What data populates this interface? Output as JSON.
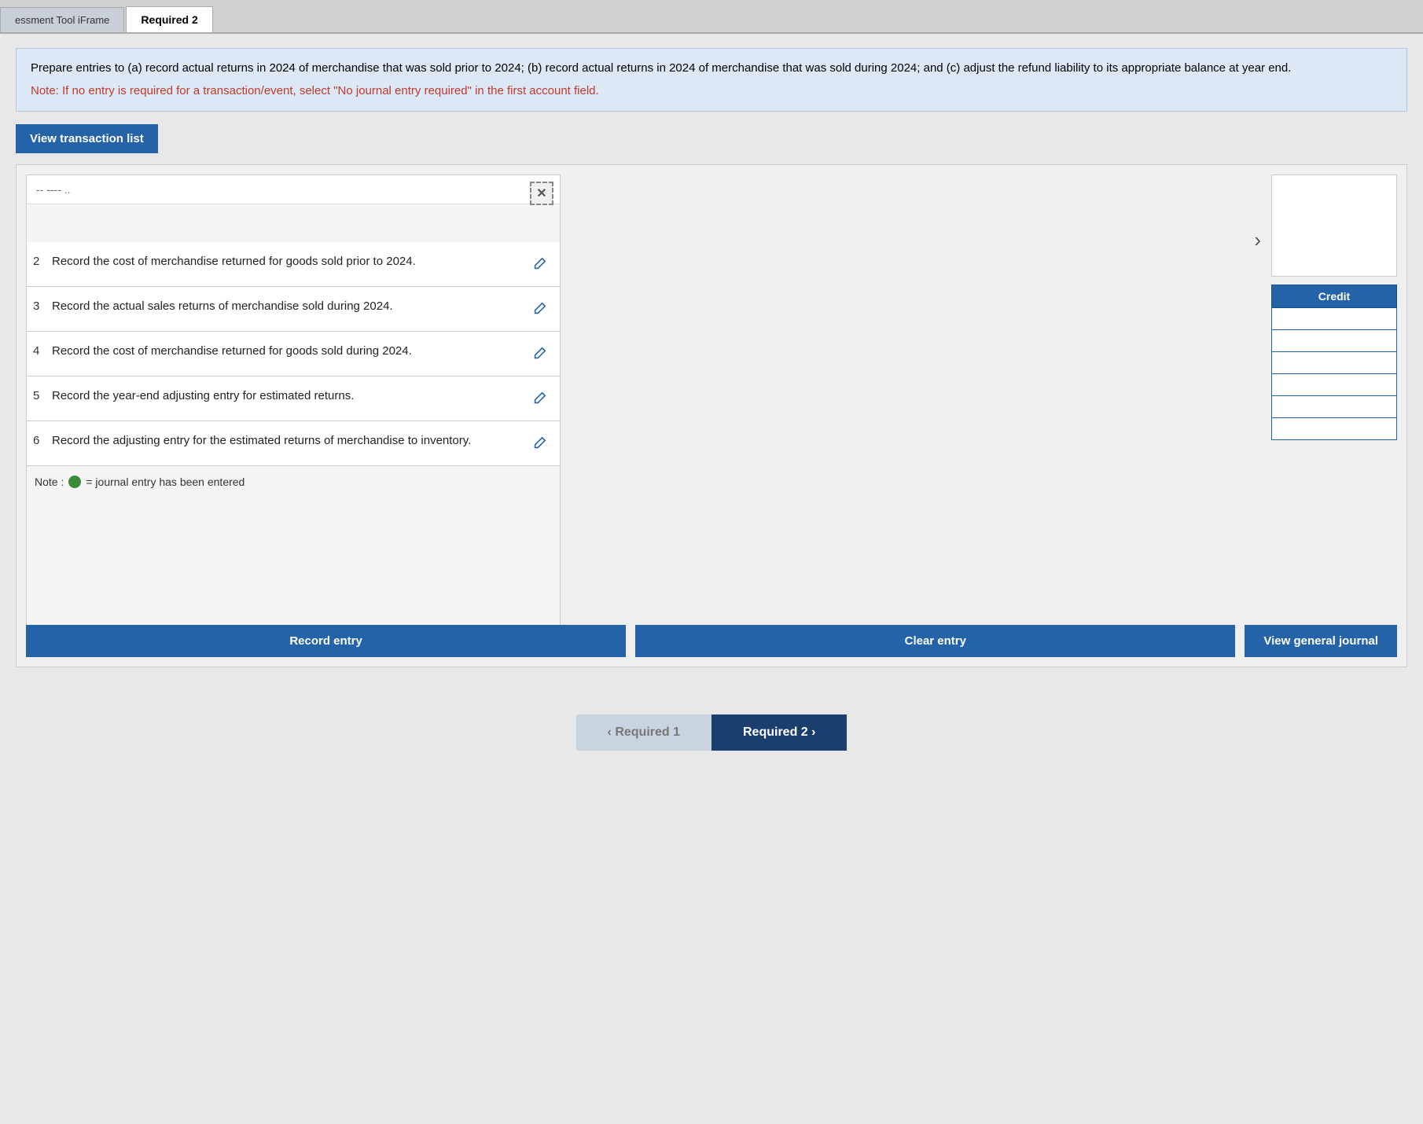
{
  "tabs": [
    {
      "label": "essment Tool iFrame",
      "active": false
    },
    {
      "label": "Required 2",
      "active": true
    }
  ],
  "info": {
    "description": "Prepare entries to (a) record actual returns in 2024 of merchandise that was sold prior to 2024; (b) record actual returns in 2024 of merchandise that was sold during 2024; and (c) adjust the refund liability to its appropriate balance at year end.",
    "note": "Note: If no entry is required for a transaction/event, select \"No journal entry required\" in the first account field."
  },
  "view_transaction_btn": "View transaction list",
  "truncated_text": "-- ---- ..",
  "transactions": [
    {
      "num": "2",
      "text": "Record the cost of merchandise returned for goods sold prior to 2024."
    },
    {
      "num": "3",
      "text": "Record the actual sales returns of merchandise sold during 2024."
    },
    {
      "num": "4",
      "text": "Record the cost of merchandise returned for goods sold during 2024."
    },
    {
      "num": "5",
      "text": "Record the year-end adjusting entry for estimated returns."
    },
    {
      "num": "6",
      "text": "Record the adjusting entry for the estimated returns of merchandise to inventory."
    }
  ],
  "note_text": "= journal entry has been entered",
  "credit_header": "Credit",
  "credit_rows": [
    "",
    "",
    "",
    "",
    "",
    ""
  ],
  "buttons": {
    "record": "Record entry",
    "clear": "Clear entry",
    "view_journal": "View general journal"
  },
  "bottom_nav": {
    "prev_label": "Required 1",
    "next_label": "Required 2"
  }
}
